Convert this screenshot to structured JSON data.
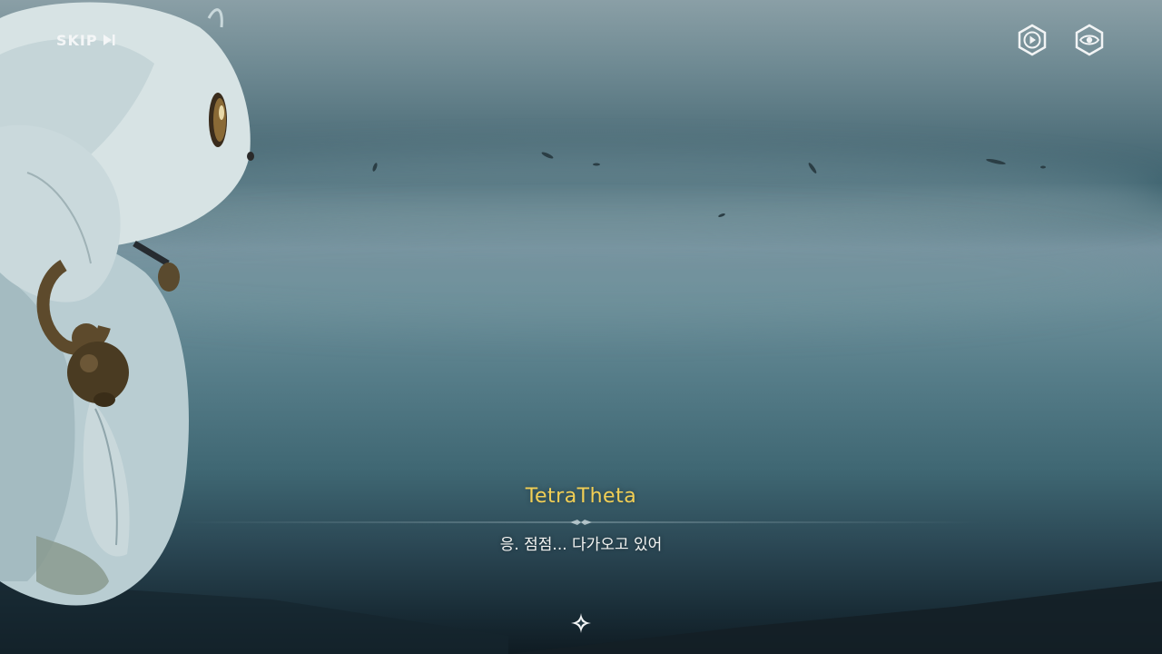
{
  "hud": {
    "skip_label": "SKIP",
    "skip_icon": "skip-forward-icon",
    "auto_play_icon": "play-icon",
    "hide_ui_icon": "eye-icon"
  },
  "dialogue": {
    "speaker": "TetraTheta",
    "line": "응. 점점... 다가오고 있어",
    "speaker_color": "#f2cf55",
    "advance_icon": "sparkle-icon"
  }
}
